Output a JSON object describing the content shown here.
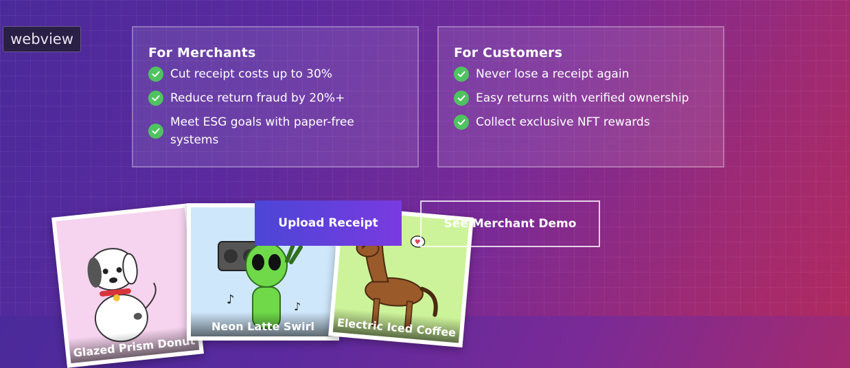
{
  "overlay": {
    "webview_label": "webview"
  },
  "merchants": {
    "title": "For Merchants",
    "items": [
      "Cut receipt costs up to 30%",
      "Reduce return fraud by 20%+",
      "Meet ESG goals with paper-free systems"
    ]
  },
  "customers": {
    "title": "For Customers",
    "items": [
      "Never lose a receipt again",
      "Easy returns with verified ownership",
      "Collect exclusive NFT rewards"
    ]
  },
  "actions": {
    "upload_label": "Upload Receipt",
    "demo_label": "See Merchant Demo"
  },
  "cards": [
    {
      "name": "Glazed Prism Donut",
      "icon": "dog-icon"
    },
    {
      "name": "Neon Latte Swirl",
      "icon": "alien-boombox-icon"
    },
    {
      "name": "Electric Iced Coffee",
      "icon": "horse-icon"
    }
  ],
  "colors": {
    "accent_check": "#4fc35f",
    "upload_button": "#5a40dc",
    "background_start": "#4a2a9a",
    "background_end": "#b02a60"
  }
}
